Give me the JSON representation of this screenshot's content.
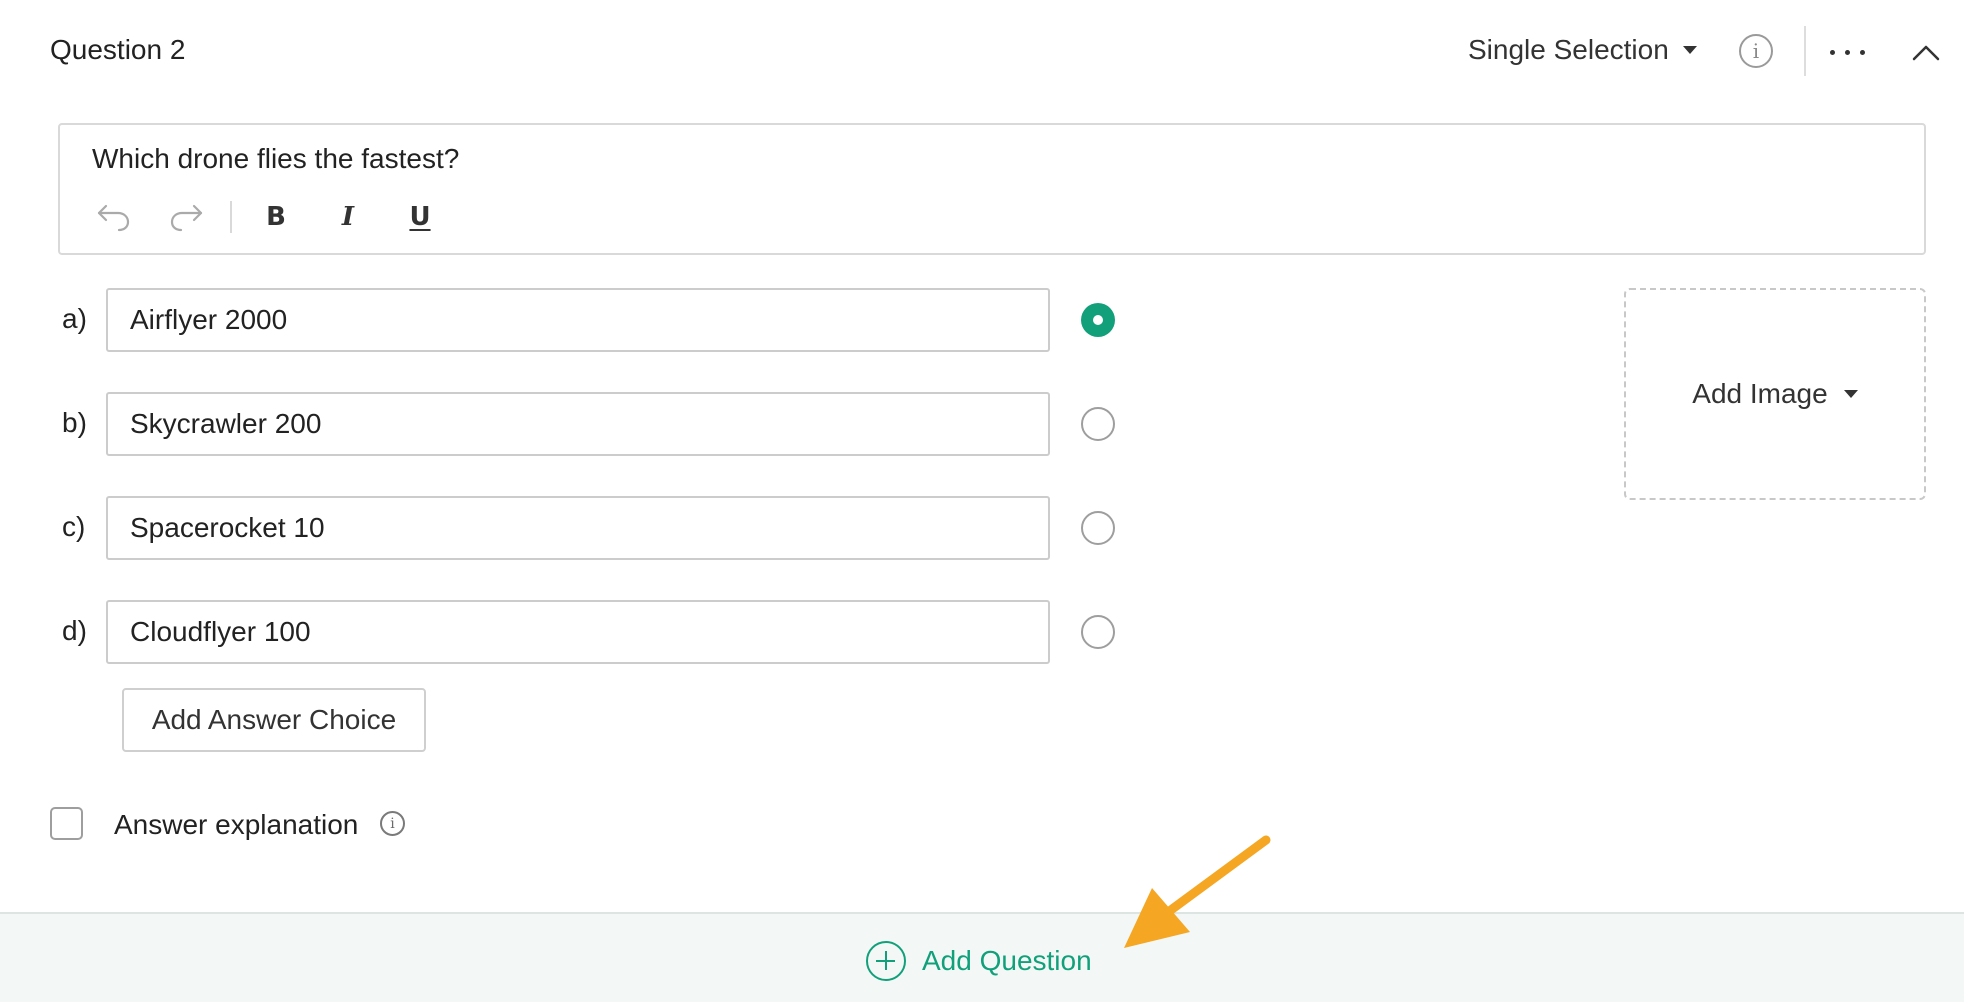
{
  "question": {
    "title": "Question 2",
    "type_label": "Single Selection",
    "text": "Which drone flies the fastest?"
  },
  "header_icons": {
    "info": "info-icon",
    "more": "more-options-icon",
    "collapse": "chevron-up-icon"
  },
  "toolbar": {
    "undo": "undo-icon",
    "redo": "redo-icon",
    "bold_label": "B",
    "italic_label": "I",
    "underline_label": "U"
  },
  "answers": [
    {
      "letter": "a)",
      "value": "Airflyer 2000",
      "selected": true
    },
    {
      "letter": "b)",
      "value": "Skycrawler 200",
      "selected": false
    },
    {
      "letter": "c)",
      "value": "Spacerocket 10",
      "selected": false
    },
    {
      "letter": "d)",
      "value": "Cloudflyer 100",
      "selected": false
    }
  ],
  "add_answer_label": "Add Answer Choice",
  "add_image_label": "Add Image",
  "answer_explanation_label": "Answer explanation",
  "add_question_label": "Add Question",
  "colors": {
    "accent": "#12a07b",
    "annotation_arrow": "#f5a623"
  }
}
